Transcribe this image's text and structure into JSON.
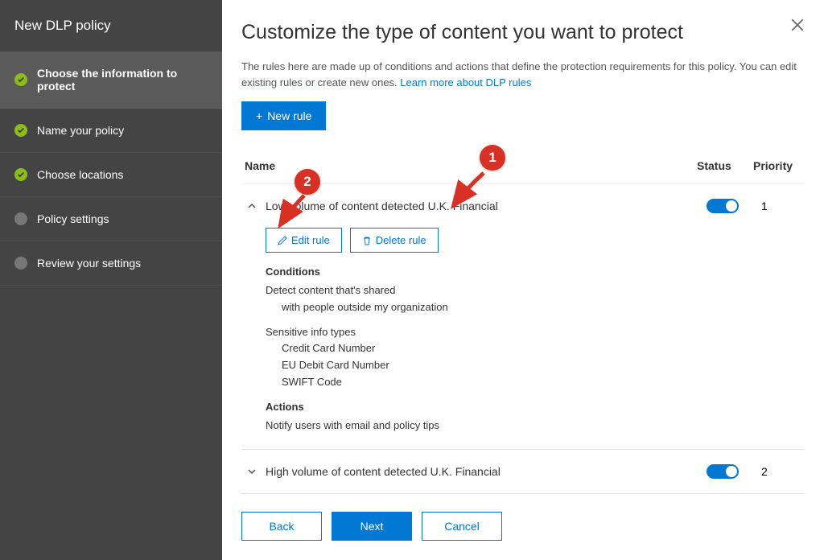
{
  "sidebar": {
    "title": "New DLP policy",
    "steps": [
      {
        "label": "Choose the information to protect",
        "status": "done",
        "active": true
      },
      {
        "label": "Name your policy",
        "status": "done",
        "active": false
      },
      {
        "label": "Choose locations",
        "status": "done",
        "active": false
      },
      {
        "label": "Policy settings",
        "status": "pending",
        "active": false
      },
      {
        "label": "Review your settings",
        "status": "pending",
        "active": false
      }
    ]
  },
  "main": {
    "title": "Customize the type of content you want to protect",
    "description_pre": "The rules here are made up of conditions and actions that define the protection requirements for this policy. You can edit existing rules or create new ones. ",
    "description_link": "Learn more about DLP rules",
    "new_rule_label": "New rule",
    "columns": {
      "name": "Name",
      "status": "Status",
      "priority": "Priority"
    },
    "rules": [
      {
        "name": "Low volume of content detected U.K. Financial",
        "expanded": true,
        "status_on": true,
        "priority": "1",
        "edit_label": "Edit rule",
        "delete_label": "Delete rule",
        "details": {
          "conditions_label": "Conditions",
          "conditions": [
            {
              "text": "Detect content that's shared",
              "sub": [
                "with people outside my organization"
              ]
            },
            {
              "text": "Sensitive info types",
              "sub": [
                "Credit Card Number",
                "EU Debit Card Number",
                "SWIFT Code"
              ]
            }
          ],
          "actions_label": "Actions",
          "actions": [
            "Notify users with email and policy tips"
          ]
        }
      },
      {
        "name": "High volume of content detected U.K. Financial",
        "expanded": false,
        "status_on": true,
        "priority": "2"
      }
    ],
    "footer": {
      "back": "Back",
      "next": "Next",
      "cancel": "Cancel"
    }
  },
  "annotations": {
    "b1": "1",
    "b2": "2"
  }
}
